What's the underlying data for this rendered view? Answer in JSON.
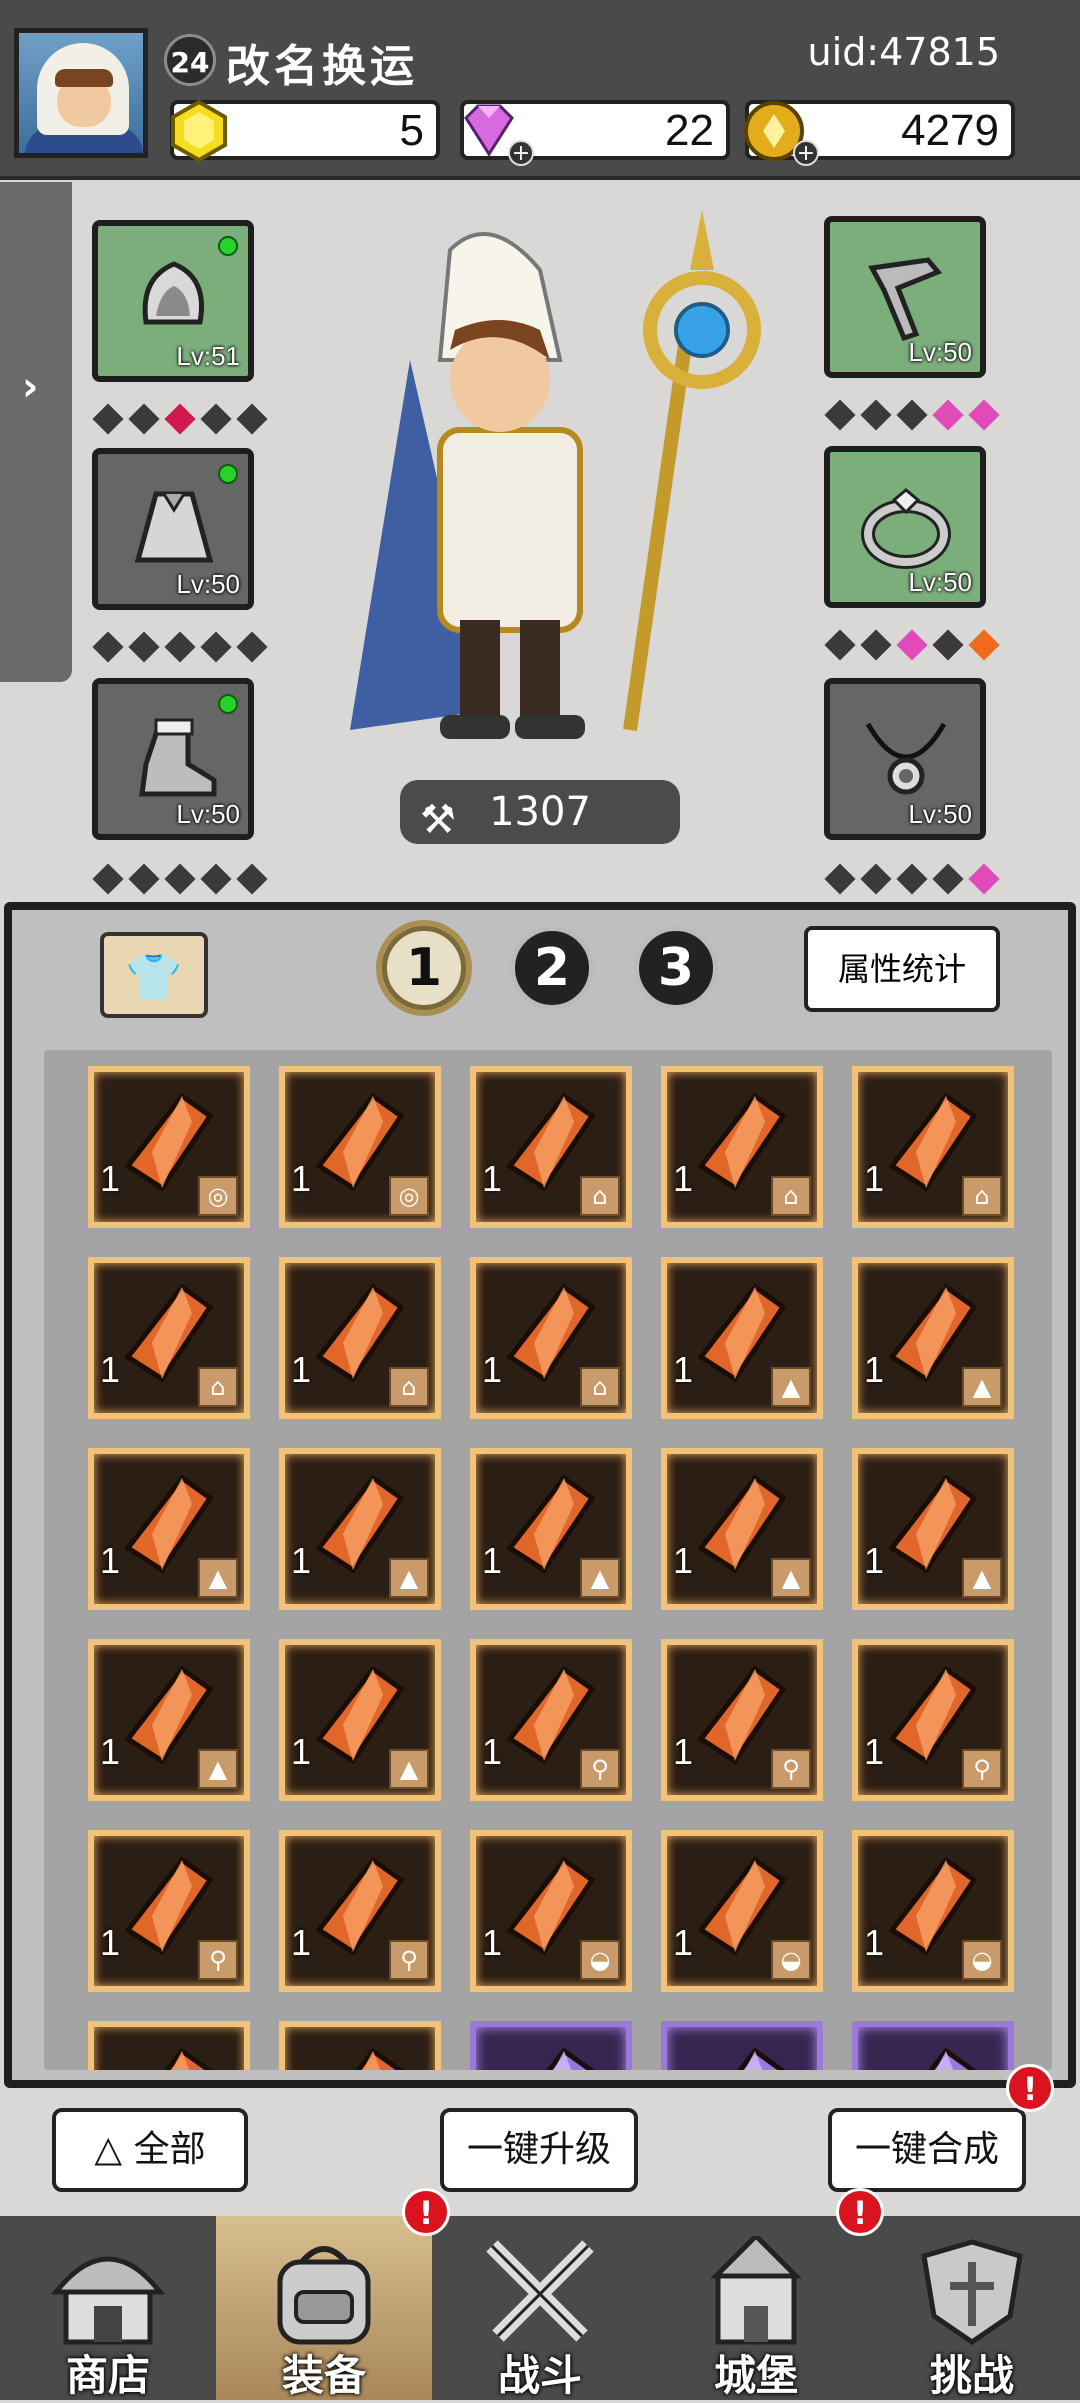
{
  "player": {
    "level": "24",
    "name": "改名换运",
    "uid": "uid:47815"
  },
  "resources": {
    "gold_gem": "5",
    "diamond": "22",
    "coin": "4279"
  },
  "character": {
    "power": "1307"
  },
  "equipment": [
    {
      "slot": "helmet",
      "level": "Lv:51"
    },
    {
      "slot": "armor",
      "level": "Lv:50"
    },
    {
      "slot": "boots",
      "level": "Lv:50"
    },
    {
      "slot": "weapon",
      "level": "Lv:50"
    },
    {
      "slot": "ring",
      "level": "Lv:50"
    },
    {
      "slot": "necklace",
      "level": "Lv:50"
    }
  ],
  "inventory": {
    "tabs": [
      "1",
      "2",
      "3"
    ],
    "active_tab": "1",
    "stats_button": "属性统计",
    "items_count": "1"
  },
  "buttons": {
    "filter_all": "全部",
    "upgrade_all": "一键升级",
    "merge_all": "一键合成",
    "alert": "!"
  },
  "nav": [
    {
      "label": "商店",
      "icon": "shop-icon"
    },
    {
      "label": "装备",
      "icon": "backpack-icon"
    },
    {
      "label": "战斗",
      "icon": "crossed-swords-icon"
    },
    {
      "label": "城堡",
      "icon": "castle-icon"
    },
    {
      "label": "挑战",
      "icon": "challenge-shield-icon"
    }
  ],
  "colors": {
    "topbar": "#4a4a4a",
    "slot_green": "#7cae7c",
    "item_glow": "#f1c37a",
    "alert": "#d9141e"
  }
}
